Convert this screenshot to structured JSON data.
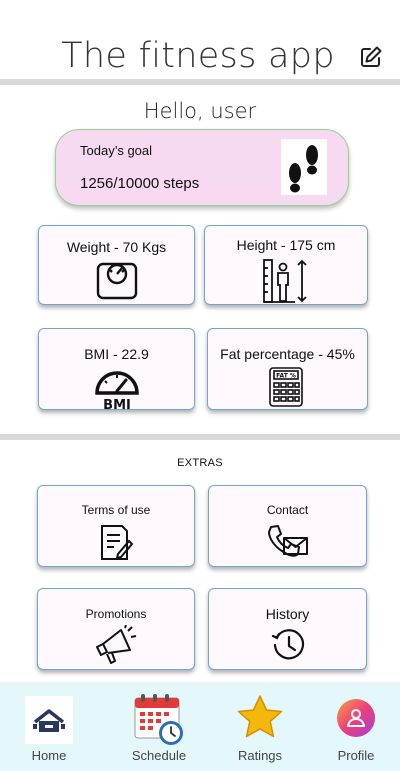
{
  "header": {
    "title": "The fitness app",
    "edit_icon": "edit-icon"
  },
  "greeting": "Hello, user",
  "goal": {
    "label": "Today’s goal",
    "value": "1256/10000 steps",
    "icon": "footprints-icon"
  },
  "stats": [
    {
      "label": "Weight  -  70 Kgs",
      "icon": "scale-icon"
    },
    {
      "label": "Height - 175 cm",
      "icon": "height-icon"
    },
    {
      "label": "BMI - 22.9",
      "icon": "bmi-gauge-icon",
      "icon_text": "BMI"
    },
    {
      "label": "Fat percentage - 45%",
      "icon": "calculator-icon",
      "icon_text": "FAT %"
    }
  ],
  "extras": {
    "title": "EXTRAS",
    "items": [
      {
        "label": "Terms of use",
        "icon": "document-icon"
      },
      {
        "label": "Contact",
        "icon": "phone-mail-icon"
      },
      {
        "label": "Promotions",
        "icon": "megaphone-icon"
      },
      {
        "label": "History",
        "icon": "history-icon"
      }
    ]
  },
  "nav": [
    {
      "label": "Home",
      "icon": "home-icon"
    },
    {
      "label": "Schedule",
      "icon": "calendar-icon"
    },
    {
      "label": "Ratings",
      "icon": "star-icon"
    },
    {
      "label": "Profile",
      "icon": "profile-icon"
    }
  ],
  "colors": {
    "goal_bg": "#f7d9f2",
    "goal_border": "#8fd58f",
    "tile_border": "#6fa6d8",
    "nav_bg": "#e4f8fb",
    "divider": "#d9d9d9"
  }
}
